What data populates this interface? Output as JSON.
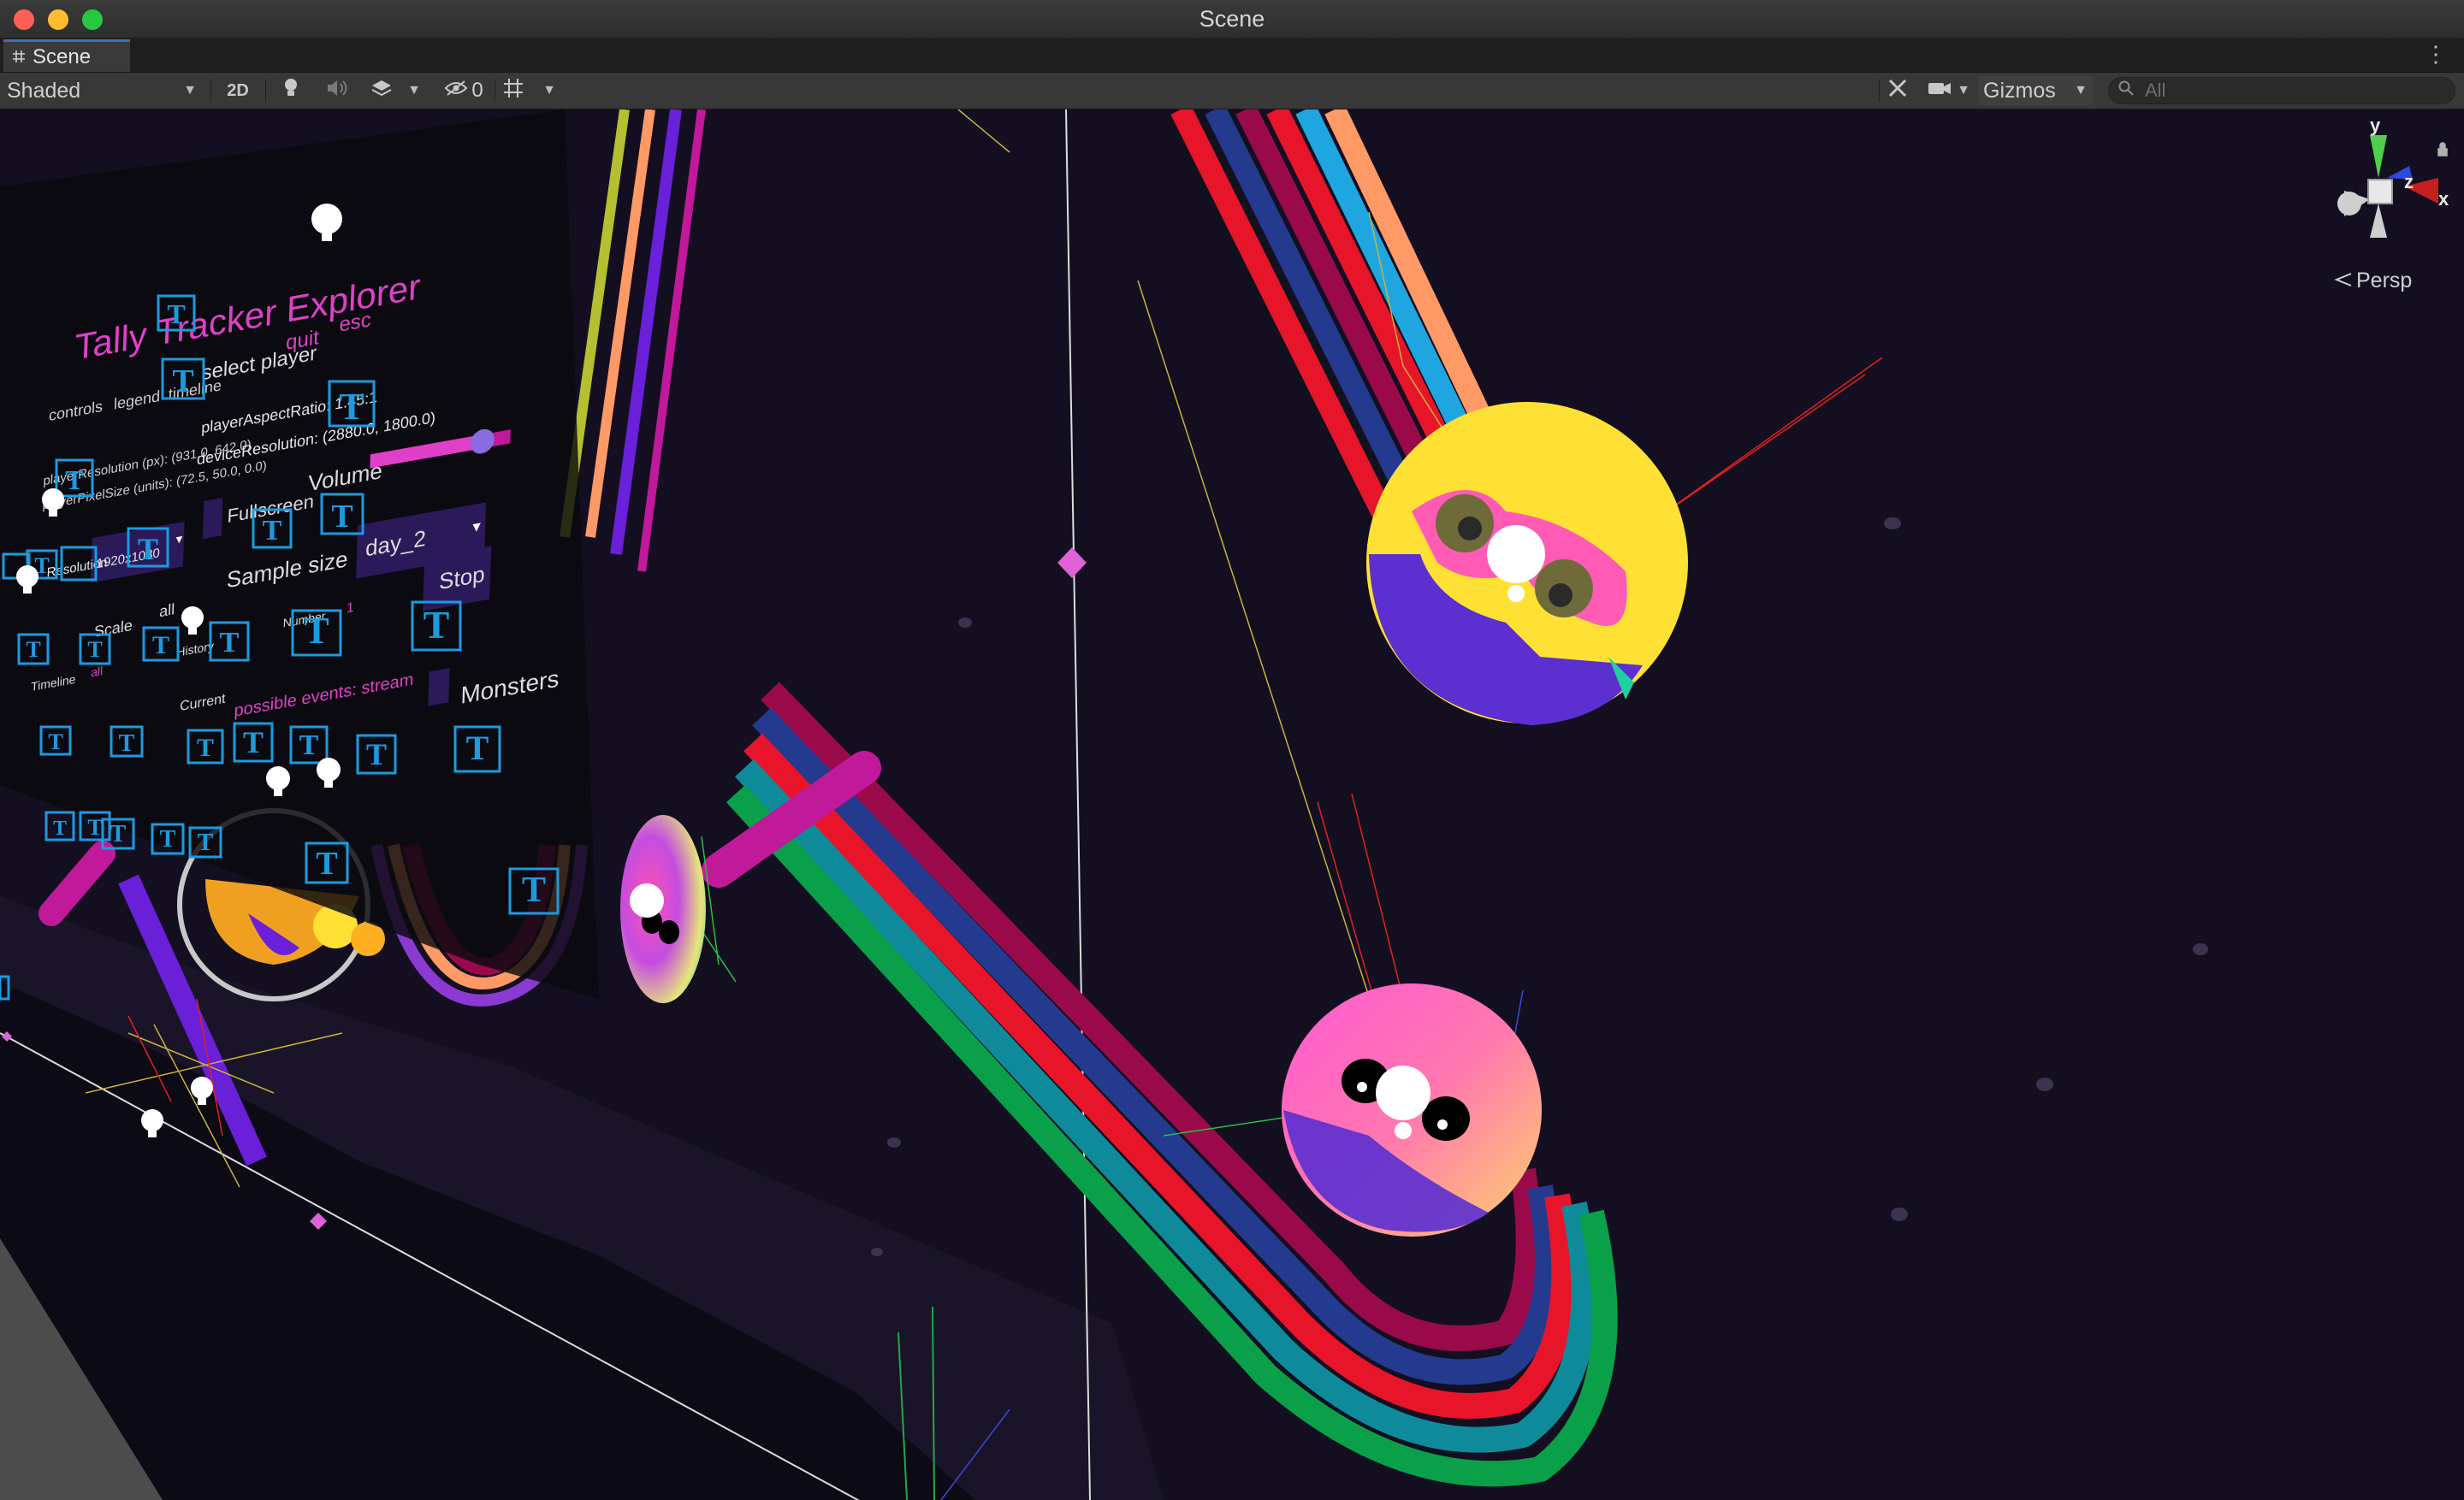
{
  "window": {
    "title": "Scene"
  },
  "tabs": [
    {
      "label": "Scene",
      "icon": "grid-icon"
    }
  ],
  "toolbar": {
    "draw_mode": "Shaded",
    "mode_2d": "2D",
    "hidden_count": "0",
    "gizmos": "Gizmos",
    "search_placeholder": "All"
  },
  "orientation_gizmo": {
    "axis_y": "y",
    "axis_z": "z",
    "axis_x": "x",
    "projection": "Persp"
  },
  "scene_ui": {
    "title": "Tally Tracker Explorer",
    "nav_controls": "controls",
    "nav_legend": "legend",
    "nav_timeline": "timeline",
    "nav_select_player": "select player",
    "nav_quit": "quit",
    "nav_esc": "esc",
    "aspect_ratio": "playerAspectRatio: 1.45:1",
    "player_resolution": "playerResolution (px): (931.0, 642.0)",
    "player_pixel_size": "playerPixelSize (units): (72.5, 50.0, 0.0)",
    "device_resolution": "deviceResolution: (2880.0, 1800.0)",
    "resolution_label": "Resolution",
    "resolution_value": "1920x1080",
    "fullscreen_label": "Fullscreen",
    "volume_label": "Volume",
    "volume_level": 0.8,
    "sample_size_label": "Sample size",
    "dataset_value": "day_2",
    "stop_label": "Stop",
    "monsters_label": "Monsters",
    "possible_events": "possible events: stream",
    "current_label": "Current",
    "row1_labels": [
      "Scale",
      "all"
    ],
    "row2_labels": [
      "Timeline",
      "all",
      "History",
      "Number",
      "1"
    ],
    "t_icon": "T"
  },
  "colors": {
    "viewport_bg": "#130f20",
    "accent_tab": "#3a72b0",
    "ui_magenta": "#e040c8",
    "ui_cyan": "#1a9be0",
    "monster_yellow": "#ffe135",
    "monster_purple": "#5b2fd0",
    "trail_red": "#e8142a",
    "trail_green": "#0aa04a",
    "trail_navy": "#233a8e",
    "trail_teal": "#0f8a9a",
    "trail_crimson": "#9a0a4a"
  }
}
